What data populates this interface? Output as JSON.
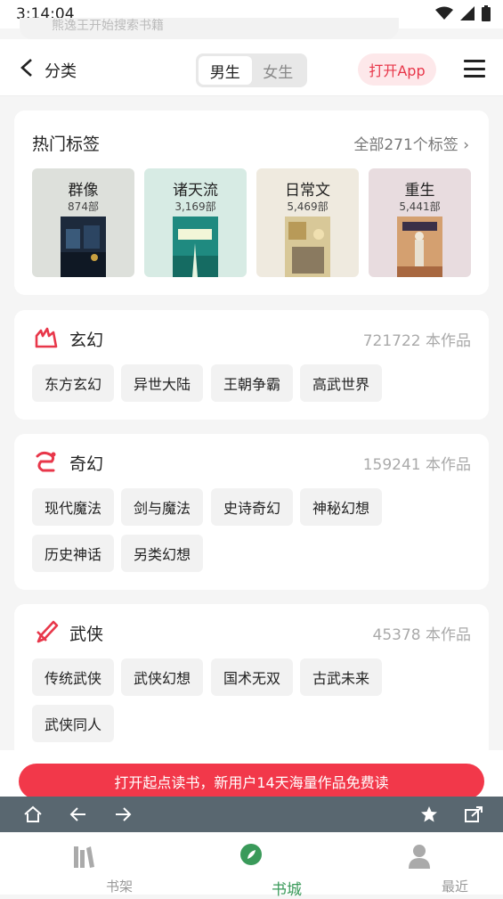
{
  "status_bar": {
    "time": "3:14:04"
  },
  "search": {
    "placeholder": "熊逸王开始搜索书籍"
  },
  "header": {
    "title": "分类",
    "gender_tabs": [
      "男生",
      "女生"
    ],
    "open_app": "打开App"
  },
  "hot_tags": {
    "title": "热门标签",
    "all_label": "全部271个标签",
    "items": [
      {
        "name": "群像",
        "count": "874部",
        "bg": "#dde0db"
      },
      {
        "name": "诸天流",
        "count": "3,169部",
        "bg": "#d7ebe4"
      },
      {
        "name": "日常文",
        "count": "5,469部",
        "bg": "#efeadf"
      },
      {
        "name": "重生",
        "count": "5,441部",
        "bg": "#e8dcdf"
      }
    ]
  },
  "categories": [
    {
      "name": "玄幻",
      "count": "721722 本作品",
      "icon": "fantasy-icon",
      "tags": [
        "东方玄幻",
        "异世大陆",
        "王朝争霸",
        "高武世界"
      ]
    },
    {
      "name": "奇幻",
      "count": "159241 本作品",
      "icon": "magic-icon",
      "tags": [
        "现代魔法",
        "剑与魔法",
        "史诗奇幻",
        "神秘幻想",
        "历史神话",
        "另类幻想"
      ]
    },
    {
      "name": "武侠",
      "count": "45378 本作品",
      "icon": "wuxia-icon",
      "tags": [
        "传统武侠",
        "武侠幻想",
        "国术无双",
        "古武未来",
        "武侠同人"
      ]
    }
  ],
  "promo": {
    "text": "打开起点读书，新用户14天海量作品免费读"
  },
  "bottom_nav": [
    {
      "label": "书架",
      "icon": "bookshelf-icon"
    },
    {
      "label": "书城",
      "icon": "bookstore-icon",
      "active": true
    },
    {
      "label": "最近",
      "icon": "recent-icon"
    }
  ],
  "colors": {
    "accent": "#e8374a",
    "active_nav": "#3a9a5a",
    "browser_bar": "#596770"
  }
}
